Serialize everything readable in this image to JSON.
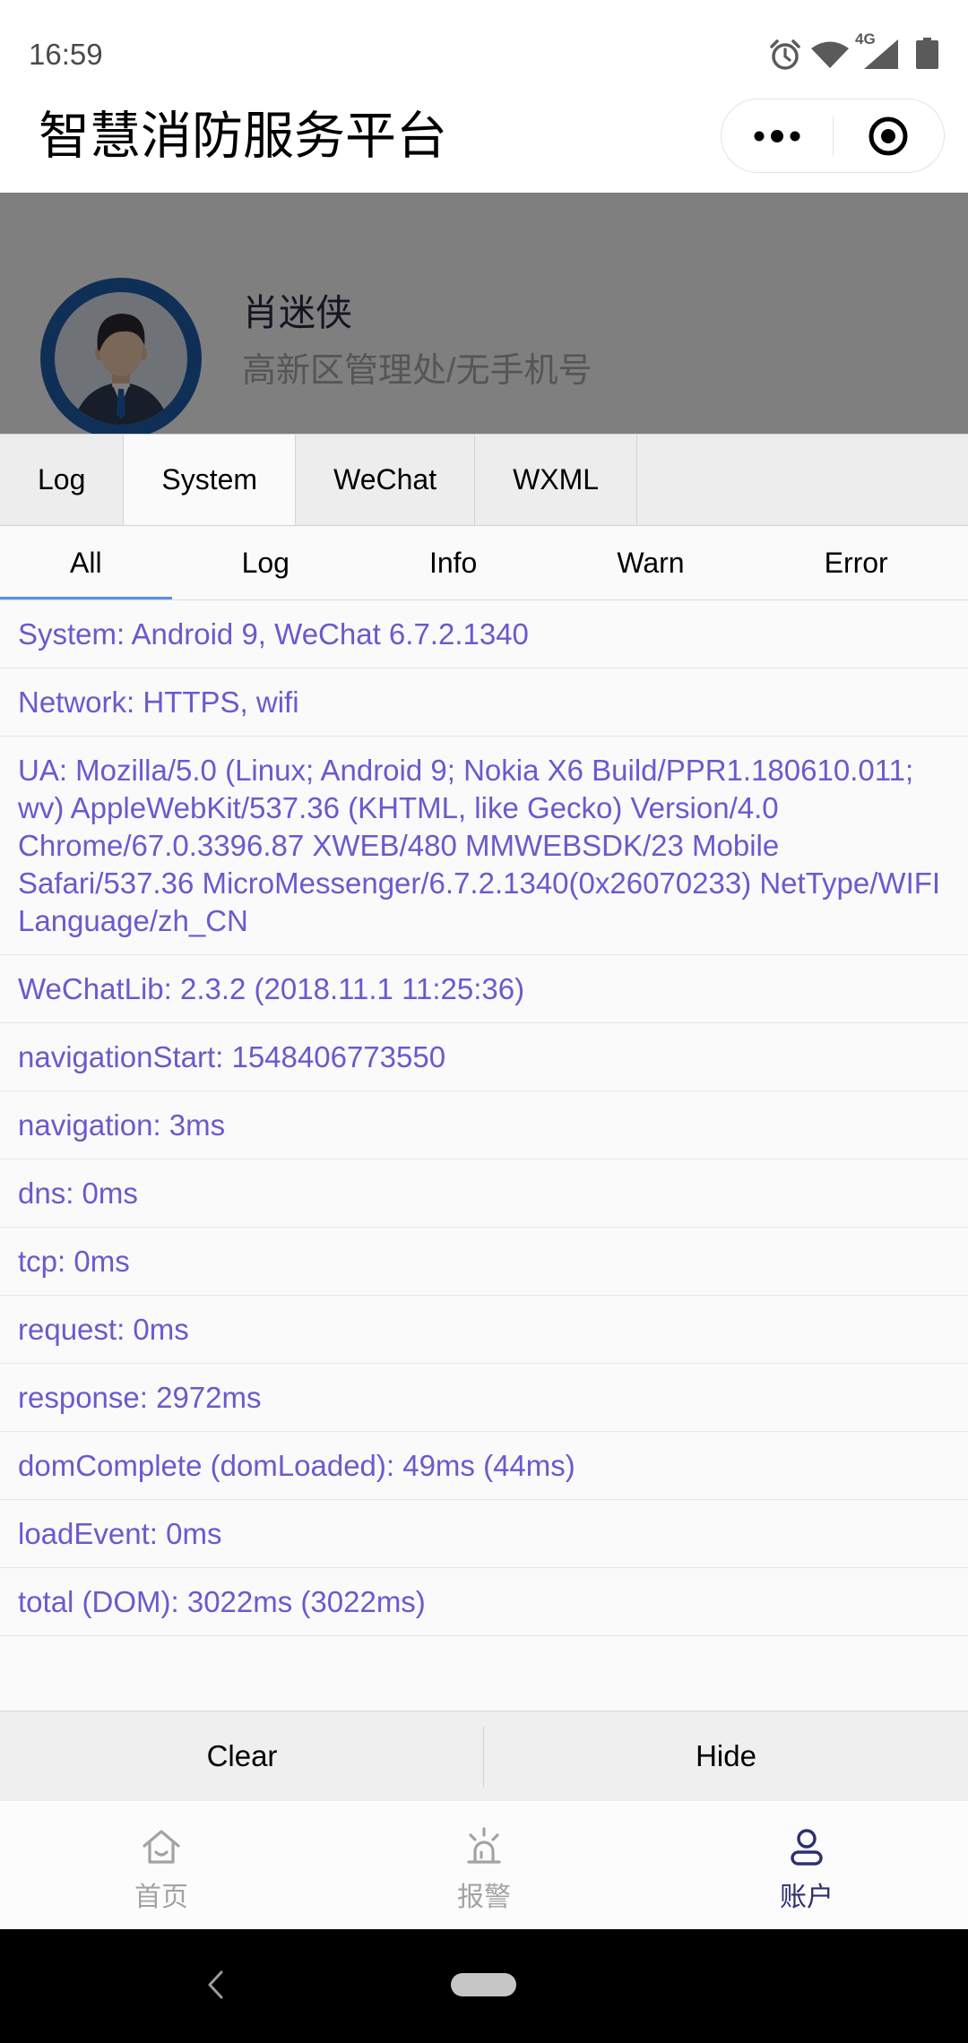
{
  "theme": {
    "log_text": "#6A5ACD",
    "subtab_underline": "#5b8def",
    "tab_active": "#2c3070",
    "tab_inactive": "#a3a3a3",
    "avatar_ring": "#1f5fae"
  },
  "status_bar": {
    "time": "16:59",
    "network_type": "4G",
    "icons": [
      "alarm-clock-icon",
      "wifi-icon",
      "cell-signal-icon",
      "battery-icon"
    ]
  },
  "header": {
    "title": "智慧消防服务平台",
    "capsule": {
      "more_icon": "more-dots-icon",
      "close_icon": "target-circle-icon"
    }
  },
  "profile": {
    "name": "肖迷侠",
    "subtitle": "高新区管理处/无手机号",
    "avatar_icon": "avatar-businessman-icon"
  },
  "vconsole": {
    "tabs": [
      {
        "label": "Log",
        "active": false
      },
      {
        "label": "System",
        "active": true
      },
      {
        "label": "WeChat",
        "active": false
      },
      {
        "label": "WXML",
        "active": false
      }
    ],
    "subtabs": [
      {
        "label": "All",
        "active": true
      },
      {
        "label": "Log",
        "active": false
      },
      {
        "label": "Info",
        "active": false
      },
      {
        "label": "Warn",
        "active": false
      },
      {
        "label": "Error",
        "active": false
      }
    ],
    "logs": [
      "System: Android 9, WeChat 6.7.2.1340",
      "Network: HTTPS, wifi",
      "UA: Mozilla/5.0 (Linux; Android 9; Nokia X6 Build/PPR1.180610.011; wv) AppleWebKit/537.36 (KHTML, like Gecko) Version/4.0 Chrome/67.0.3396.87 XWEB/480 MMWEBSDK/23 Mobile Safari/537.36 MicroMessenger/6.7.2.1340(0x26070233) NetType/WIFI Language/zh_CN",
      "WeChatLib: 2.3.2 (2018.11.1 11:25:36)",
      "navigationStart: 1548406773550",
      "navigation: 3ms",
      "dns: 0ms",
      "tcp: 0ms",
      "request: 0ms",
      "response: 2972ms",
      "domComplete (domLoaded): 49ms (44ms)",
      "loadEvent: 0ms",
      "total (DOM): 3022ms (3022ms)"
    ],
    "toolbar": {
      "clear": "Clear",
      "hide": "Hide"
    }
  },
  "tab_bar": {
    "items": [
      {
        "label": "首页",
        "icon": "home-icon",
        "active": false
      },
      {
        "label": "报警",
        "icon": "alarm-light-icon",
        "active": false
      },
      {
        "label": "账户",
        "icon": "user-icon",
        "active": true
      }
    ]
  },
  "system_nav": {
    "back_icon": "back-chevron-icon",
    "home_icon": "home-pill-icon"
  }
}
